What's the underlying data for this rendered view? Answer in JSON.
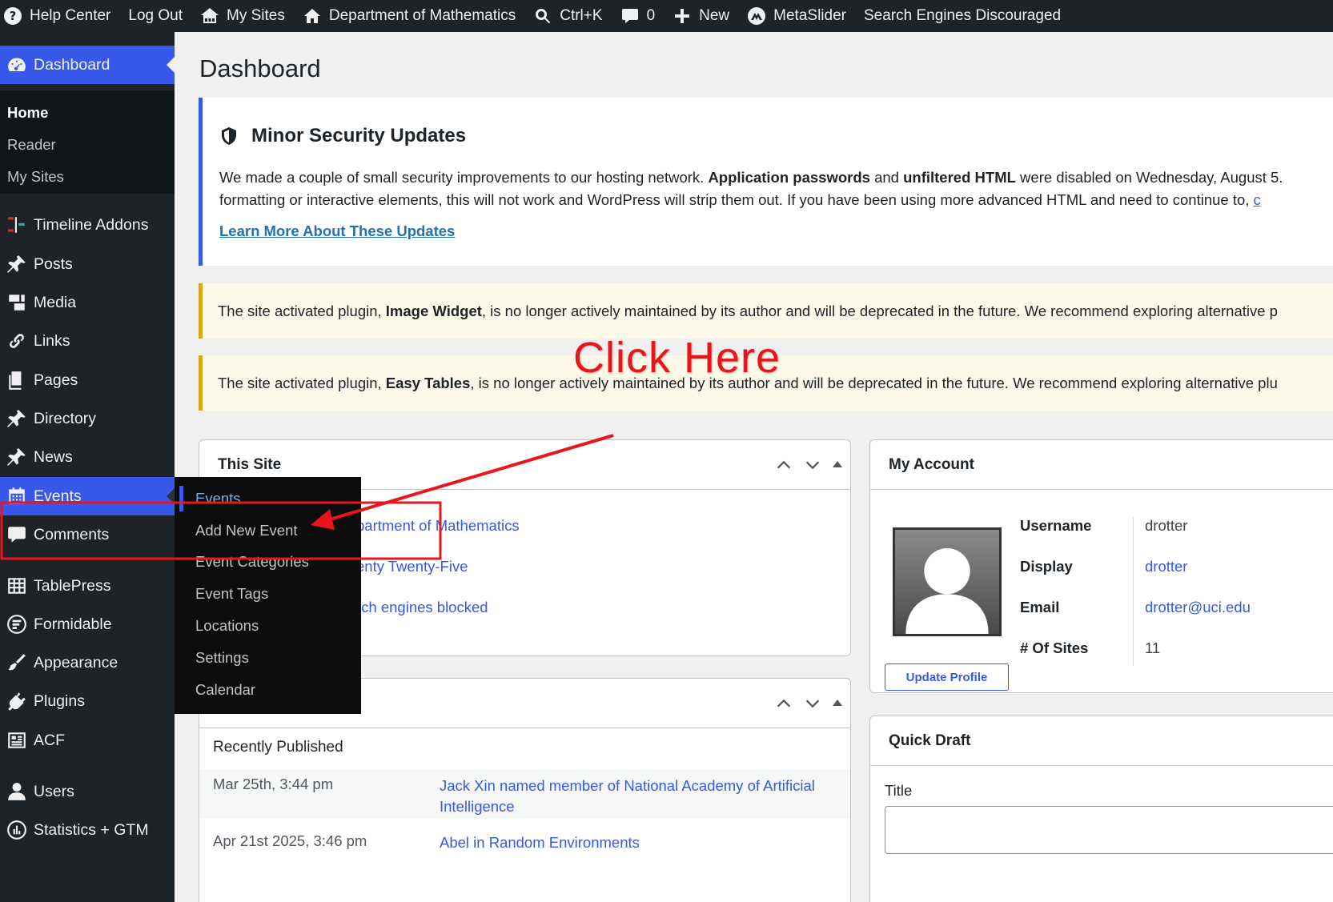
{
  "adminbar": {
    "help": "Help Center",
    "logout": "Log Out",
    "my_sites": "My Sites",
    "site_name": "Department of Mathematics",
    "search_shortcut": "Ctrl+K",
    "comments_count": "0",
    "new": "New",
    "metaslider": "MetaSlider",
    "seo_status": "Search Engines Discouraged"
  },
  "sidebar": {
    "dashboard": "Dashboard",
    "home_sub": [
      "Home",
      "Reader",
      "My Sites"
    ],
    "items": [
      "Timeline Addons",
      "Posts",
      "Media",
      "Links",
      "Pages",
      "Directory",
      "News",
      "Events",
      "Comments",
      "TablePress",
      "Formidable",
      "Appearance",
      "Plugins",
      "ACF",
      "Users",
      "Statistics + GTM"
    ]
  },
  "events_flyout": [
    "Events",
    "Add New Event",
    "Event Categories",
    "Event Tags",
    "Locations",
    "Settings",
    "Calendar"
  ],
  "page": {
    "title": "Dashboard"
  },
  "security_notice": {
    "title": "Minor Security Updates",
    "line1_a": "We made a couple of small security improvements to our hosting network. ",
    "line1_b": "Application passwords",
    "line1_c": " and ",
    "line1_d": "unfiltered HTML",
    "line1_e": " were disabled on Wednesday, August 5.",
    "line2": "formatting or interactive elements, this will not work and WordPress will strip them out. If you have been using more advanced HTML and need to continue to, ",
    "line2_link": "c",
    "link": "Learn More About These Updates"
  },
  "warn1": {
    "a": "The site activated plugin, ",
    "b": "Image Widget",
    "c": ", is no longer actively maintained by its author and will be deprecated in the future. We recommend exploring alternative p"
  },
  "warn2": {
    "a": "The site activated plugin, ",
    "b": "Easy Tables",
    "c": ", is no longer actively maintained by its author and will be deprecated in the future. We recommend exploring alternative plu"
  },
  "this_site": {
    "title": "This Site",
    "links": [
      "partment of Mathematics",
      "enty Twenty-Five",
      "rch engines blocked"
    ]
  },
  "activity": {
    "heading": "Recently Published",
    "rows": [
      {
        "date": "Mar 25th, 3:44 pm",
        "title": "Jack Xin named member of National Academy of Artificial Intelligence"
      },
      {
        "date": "Apr 21st 2025, 3:46 pm",
        "title": "Abel in Random Environments"
      }
    ]
  },
  "account": {
    "title": "My Account",
    "username_label": "Username",
    "username": "drotter",
    "display_label": "Display",
    "display": "drotter",
    "email_label": "Email",
    "email": "drotter@uci.edu",
    "sites_label": "# Of Sites",
    "sites": "11",
    "update_button": "Update Profile"
  },
  "quick_draft": {
    "title": "Quick Draft",
    "title_label": "Title"
  },
  "annotation": {
    "text": "Click Here",
    "color": "#e8151d"
  },
  "colors": {
    "accent": "#3858e9",
    "sidebar": "#1d2327",
    "warning": "#dba617"
  }
}
